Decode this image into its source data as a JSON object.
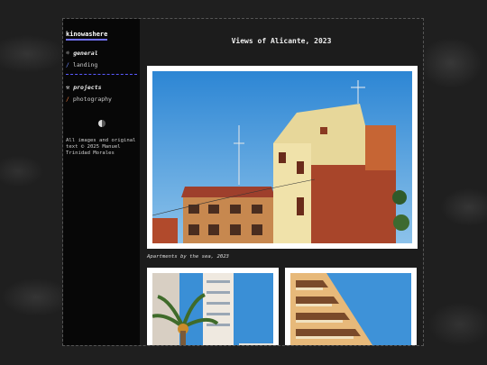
{
  "sidebar": {
    "brand": "kinowashere",
    "sections": [
      {
        "label": "general",
        "icon": "sun-icon",
        "items": [
          {
            "label": "landing"
          }
        ]
      },
      {
        "label": "projects",
        "icon": "tools-icon",
        "items": [
          {
            "label": "photography"
          }
        ]
      }
    ],
    "copyright": "All images and original text © 2025 Manuel Trinidad Morales"
  },
  "main": {
    "title": "Views of Alicante, 2023",
    "photos": [
      {
        "caption": "Apartments by the sea, 2023"
      }
    ]
  },
  "colors": {
    "accent_blue": "#6f6ff0",
    "accent_orange": "#f07a3c",
    "sky": "#3a8fd6"
  }
}
